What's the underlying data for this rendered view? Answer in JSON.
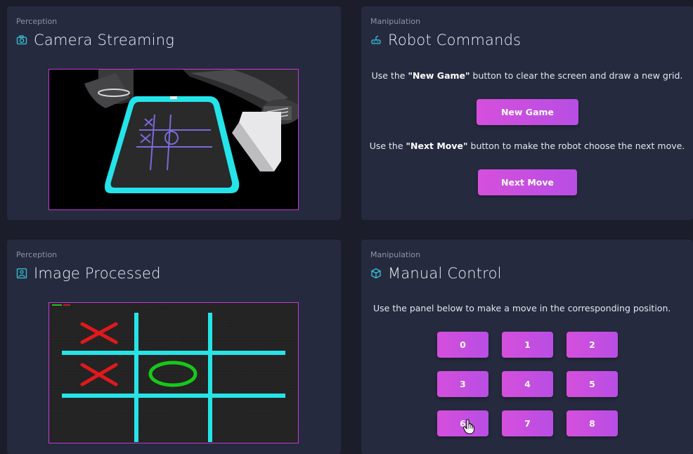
{
  "camera_card": {
    "category": "Perception",
    "title": "Camera Streaming",
    "icon": "camera-icon"
  },
  "commands_card": {
    "category": "Manipulation",
    "title": "Robot Commands",
    "icon": "robot-icon",
    "new_game_pre": "Use the ",
    "new_game_quote": "\"New Game\"",
    "new_game_post": " button to clear the screen and draw a new grid.",
    "new_game_label": "New Game",
    "next_move_pre": "Use the ",
    "next_move_quote": "\"Next Move\"",
    "next_move_post": " button to make the robot choose the next move.",
    "next_move_label": "Next Move"
  },
  "processed_card": {
    "category": "Perception",
    "title": "Image Processed",
    "icon": "image-icon"
  },
  "manual_card": {
    "category": "Manipulation",
    "title": "Manual Control",
    "icon": "cube-icon",
    "description": "Use the panel below to make a move in the corresponding position.",
    "positions": [
      "0",
      "1",
      "2",
      "3",
      "4",
      "5",
      "6",
      "7",
      "8"
    ]
  },
  "colors": {
    "background": "#1b1d2b",
    "card": "#262a3f",
    "accent": "#c84fe0",
    "icon": "#35c6d8",
    "frame_border": "#c23bd4",
    "grid_cyan": "#26e4e6",
    "x_red": "#e0191c",
    "o_green": "#17c81a"
  }
}
